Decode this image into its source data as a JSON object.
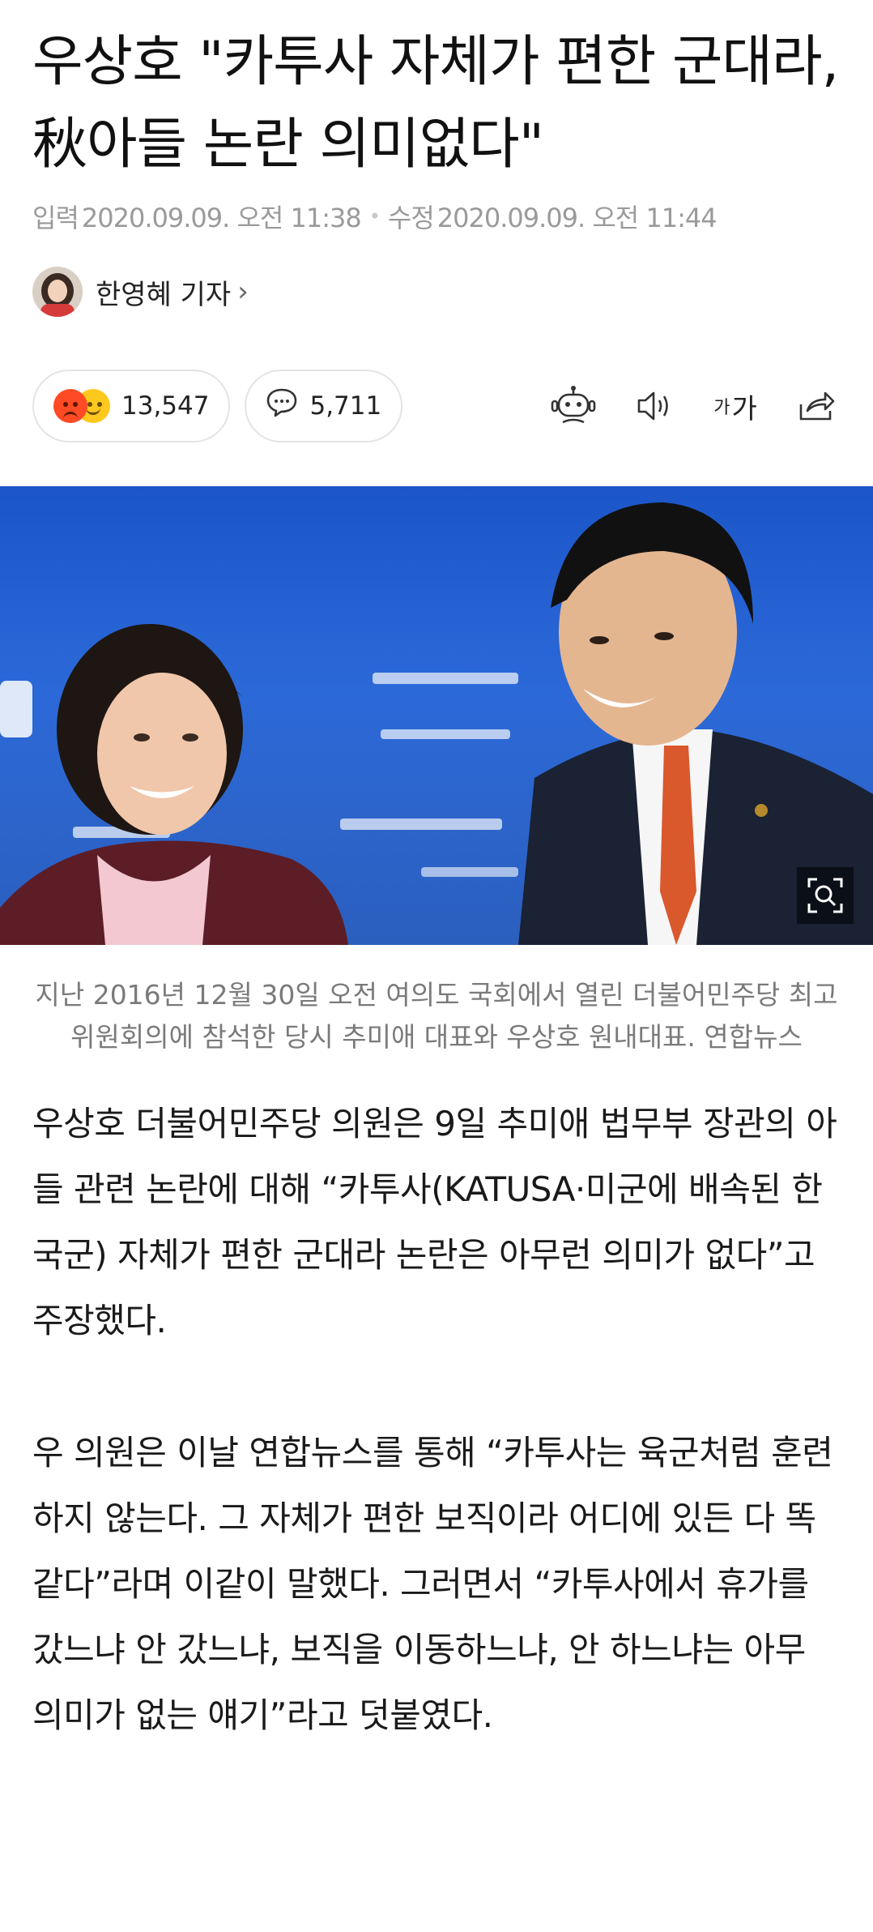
{
  "article": {
    "title": "우상호 \"카투사 자체가 편한 군대라, 秋아들 논란 의미없다\"",
    "input_label": "입력",
    "input_time": "2020.09.09. 오전 11:38",
    "edit_label": "수정",
    "edit_time": "2020.09.09. 오전 11:44",
    "author": "한영혜 기자"
  },
  "actions": {
    "reactions_count": "13,547",
    "comments_count": "5,711",
    "font_label_small": "가",
    "font_label_large": "가"
  },
  "photo": {
    "caption": "지난 2016년 12월 30일 오전 여의도 국회에서 열린 더불어민주당 최고위원회의에 참석한 당시 추미애 대표와 우상호 원내대표. 연합뉴스"
  },
  "body": {
    "paragraphs": [
      "우상호 더불어민주당 의원은 9일 추미애 법무부 장관의 아들 관련 논란에 대해 “카투사(KATUSA·미군에 배속된 한국군) 자체가 편한 군대라 논란은 아무런 의미가 없다”고 주장했다.",
      "우 의원은 이날 연합뉴스를 통해 “카투사는 육군처럼 훈련하지 않는다. 그 자체가 편한 보직이라 어디에 있든 다 똑같다”라며 이같이 말했다. 그러면서 “카투사에서 휴가를 갔느냐 안 갔느냐, 보직을 이동하느냐, 안 하느냐는 아무 의미가 없는 얘기”라고 덧붙였다."
    ]
  },
  "icons": [
    "angry-emoji-icon",
    "smile-emoji-icon",
    "comment-icon",
    "robot-icon",
    "speaker-icon",
    "font-size-icon",
    "share-icon",
    "zoom-icon",
    "chevron-right-icon"
  ],
  "colors": {
    "photo_background": "#1b56c9",
    "angry": "#ff4b25",
    "smile": "#ffc81e"
  }
}
